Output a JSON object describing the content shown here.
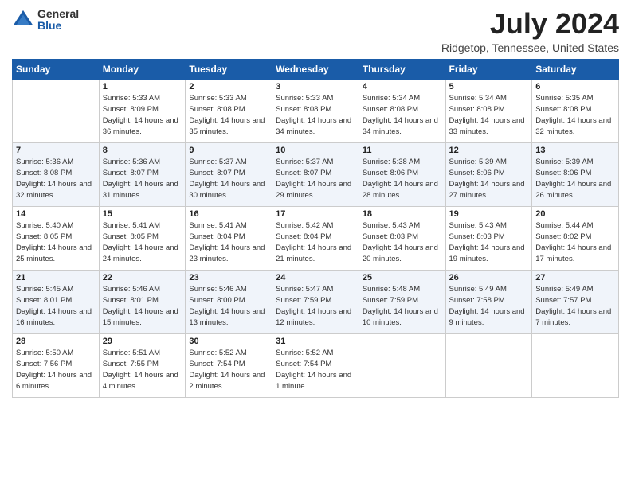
{
  "header": {
    "logo_general": "General",
    "logo_blue": "Blue",
    "month_title": "July 2024",
    "location": "Ridgetop, Tennessee, United States"
  },
  "weekdays": [
    "Sunday",
    "Monday",
    "Tuesday",
    "Wednesday",
    "Thursday",
    "Friday",
    "Saturday"
  ],
  "weeks": [
    [
      {
        "day": "",
        "sunrise": "",
        "sunset": "",
        "daylight": ""
      },
      {
        "day": "1",
        "sunrise": "Sunrise: 5:33 AM",
        "sunset": "Sunset: 8:09 PM",
        "daylight": "Daylight: 14 hours and 36 minutes."
      },
      {
        "day": "2",
        "sunrise": "Sunrise: 5:33 AM",
        "sunset": "Sunset: 8:08 PM",
        "daylight": "Daylight: 14 hours and 35 minutes."
      },
      {
        "day": "3",
        "sunrise": "Sunrise: 5:33 AM",
        "sunset": "Sunset: 8:08 PM",
        "daylight": "Daylight: 14 hours and 34 minutes."
      },
      {
        "day": "4",
        "sunrise": "Sunrise: 5:34 AM",
        "sunset": "Sunset: 8:08 PM",
        "daylight": "Daylight: 14 hours and 34 minutes."
      },
      {
        "day": "5",
        "sunrise": "Sunrise: 5:34 AM",
        "sunset": "Sunset: 8:08 PM",
        "daylight": "Daylight: 14 hours and 33 minutes."
      },
      {
        "day": "6",
        "sunrise": "Sunrise: 5:35 AM",
        "sunset": "Sunset: 8:08 PM",
        "daylight": "Daylight: 14 hours and 32 minutes."
      }
    ],
    [
      {
        "day": "7",
        "sunrise": "Sunrise: 5:36 AM",
        "sunset": "Sunset: 8:08 PM",
        "daylight": "Daylight: 14 hours and 32 minutes."
      },
      {
        "day": "8",
        "sunrise": "Sunrise: 5:36 AM",
        "sunset": "Sunset: 8:07 PM",
        "daylight": "Daylight: 14 hours and 31 minutes."
      },
      {
        "day": "9",
        "sunrise": "Sunrise: 5:37 AM",
        "sunset": "Sunset: 8:07 PM",
        "daylight": "Daylight: 14 hours and 30 minutes."
      },
      {
        "day": "10",
        "sunrise": "Sunrise: 5:37 AM",
        "sunset": "Sunset: 8:07 PM",
        "daylight": "Daylight: 14 hours and 29 minutes."
      },
      {
        "day": "11",
        "sunrise": "Sunrise: 5:38 AM",
        "sunset": "Sunset: 8:06 PM",
        "daylight": "Daylight: 14 hours and 28 minutes."
      },
      {
        "day": "12",
        "sunrise": "Sunrise: 5:39 AM",
        "sunset": "Sunset: 8:06 PM",
        "daylight": "Daylight: 14 hours and 27 minutes."
      },
      {
        "day": "13",
        "sunrise": "Sunrise: 5:39 AM",
        "sunset": "Sunset: 8:06 PM",
        "daylight": "Daylight: 14 hours and 26 minutes."
      }
    ],
    [
      {
        "day": "14",
        "sunrise": "Sunrise: 5:40 AM",
        "sunset": "Sunset: 8:05 PM",
        "daylight": "Daylight: 14 hours and 25 minutes."
      },
      {
        "day": "15",
        "sunrise": "Sunrise: 5:41 AM",
        "sunset": "Sunset: 8:05 PM",
        "daylight": "Daylight: 14 hours and 24 minutes."
      },
      {
        "day": "16",
        "sunrise": "Sunrise: 5:41 AM",
        "sunset": "Sunset: 8:04 PM",
        "daylight": "Daylight: 14 hours and 23 minutes."
      },
      {
        "day": "17",
        "sunrise": "Sunrise: 5:42 AM",
        "sunset": "Sunset: 8:04 PM",
        "daylight": "Daylight: 14 hours and 21 minutes."
      },
      {
        "day": "18",
        "sunrise": "Sunrise: 5:43 AM",
        "sunset": "Sunset: 8:03 PM",
        "daylight": "Daylight: 14 hours and 20 minutes."
      },
      {
        "day": "19",
        "sunrise": "Sunrise: 5:43 AM",
        "sunset": "Sunset: 8:03 PM",
        "daylight": "Daylight: 14 hours and 19 minutes."
      },
      {
        "day": "20",
        "sunrise": "Sunrise: 5:44 AM",
        "sunset": "Sunset: 8:02 PM",
        "daylight": "Daylight: 14 hours and 17 minutes."
      }
    ],
    [
      {
        "day": "21",
        "sunrise": "Sunrise: 5:45 AM",
        "sunset": "Sunset: 8:01 PM",
        "daylight": "Daylight: 14 hours and 16 minutes."
      },
      {
        "day": "22",
        "sunrise": "Sunrise: 5:46 AM",
        "sunset": "Sunset: 8:01 PM",
        "daylight": "Daylight: 14 hours and 15 minutes."
      },
      {
        "day": "23",
        "sunrise": "Sunrise: 5:46 AM",
        "sunset": "Sunset: 8:00 PM",
        "daylight": "Daylight: 14 hours and 13 minutes."
      },
      {
        "day": "24",
        "sunrise": "Sunrise: 5:47 AM",
        "sunset": "Sunset: 7:59 PM",
        "daylight": "Daylight: 14 hours and 12 minutes."
      },
      {
        "day": "25",
        "sunrise": "Sunrise: 5:48 AM",
        "sunset": "Sunset: 7:59 PM",
        "daylight": "Daylight: 14 hours and 10 minutes."
      },
      {
        "day": "26",
        "sunrise": "Sunrise: 5:49 AM",
        "sunset": "Sunset: 7:58 PM",
        "daylight": "Daylight: 14 hours and 9 minutes."
      },
      {
        "day": "27",
        "sunrise": "Sunrise: 5:49 AM",
        "sunset": "Sunset: 7:57 PM",
        "daylight": "Daylight: 14 hours and 7 minutes."
      }
    ],
    [
      {
        "day": "28",
        "sunrise": "Sunrise: 5:50 AM",
        "sunset": "Sunset: 7:56 PM",
        "daylight": "Daylight: 14 hours and 6 minutes."
      },
      {
        "day": "29",
        "sunrise": "Sunrise: 5:51 AM",
        "sunset": "Sunset: 7:55 PM",
        "daylight": "Daylight: 14 hours and 4 minutes."
      },
      {
        "day": "30",
        "sunrise": "Sunrise: 5:52 AM",
        "sunset": "Sunset: 7:54 PM",
        "daylight": "Daylight: 14 hours and 2 minutes."
      },
      {
        "day": "31",
        "sunrise": "Sunrise: 5:52 AM",
        "sunset": "Sunset: 7:54 PM",
        "daylight": "Daylight: 14 hours and 1 minute."
      },
      {
        "day": "",
        "sunrise": "",
        "sunset": "",
        "daylight": ""
      },
      {
        "day": "",
        "sunrise": "",
        "sunset": "",
        "daylight": ""
      },
      {
        "day": "",
        "sunrise": "",
        "sunset": "",
        "daylight": ""
      }
    ]
  ]
}
